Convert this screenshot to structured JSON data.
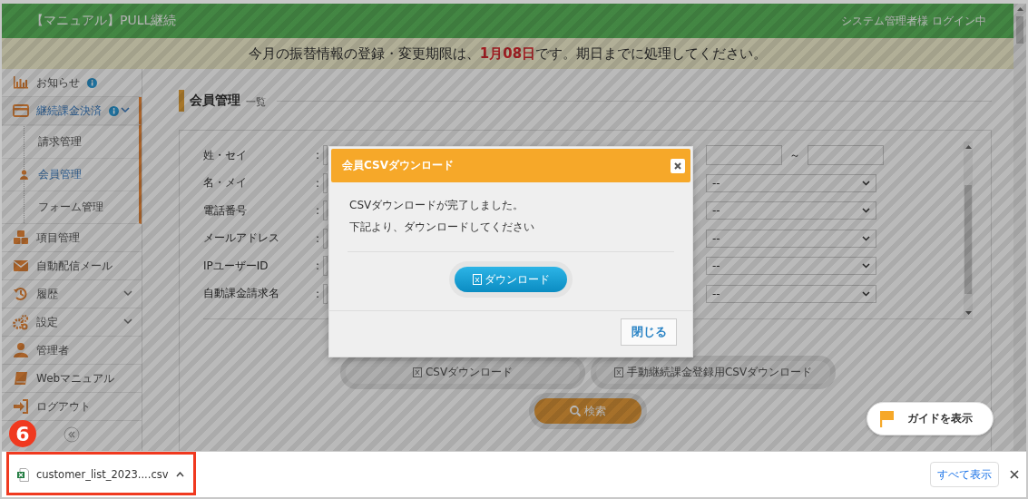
{
  "header": {
    "title": "【マニュアル】PULL継続",
    "user": "システム管理者様 ログイン中"
  },
  "notice": {
    "text": "今月の振替情報の登録・変更期限は、**1月08日**です。期日までに処理してください。"
  },
  "sidebar": {
    "items": [
      {
        "label": "お知らせ",
        "info": true,
        "selected": false
      },
      {
        "label": "継続課金決済",
        "info": true,
        "selected": true,
        "expanded": true,
        "children": [
          {
            "label": "請求管理",
            "selected": false
          },
          {
            "label": "会員管理",
            "selected": true
          },
          {
            "label": "フォーム管理",
            "selected": false
          }
        ]
      },
      {
        "label": "項目管理",
        "info": false,
        "selected": false
      },
      {
        "label": "自動配信メール",
        "info": false,
        "selected": false
      },
      {
        "label": "履歴",
        "info": false,
        "selected": false,
        "expanded": false
      },
      {
        "label": "設定",
        "info": false,
        "selected": false,
        "expanded": false
      },
      {
        "label": "管理者",
        "info": false,
        "selected": false
      },
      {
        "label": "Webマニュアル",
        "info": false,
        "selected": false
      },
      {
        "label": "ログアウト",
        "info": false,
        "selected": false
      }
    ]
  },
  "page": {
    "title": "会員管理",
    "subtitle": "一覧"
  },
  "search_form": {
    "fields": [
      {
        "label": "姓・セイ",
        "colon": ":"
      },
      {
        "label": "名・メイ",
        "colon": ":"
      },
      {
        "label": "電話番号",
        "colon": ":"
      },
      {
        "label": "メールアドレス",
        "colon": ":"
      },
      {
        "label": "IPユーザーID",
        "colon": ":"
      },
      {
        "label": "自動課金請求名",
        "colon": ":"
      }
    ],
    "right_rows": [
      {
        "kind": "range",
        "separator": "～"
      },
      {
        "kind": "select",
        "value": "--"
      },
      {
        "kind": "select",
        "value": "--"
      },
      {
        "kind": "select",
        "value": "--"
      },
      {
        "kind": "select",
        "value": "--"
      },
      {
        "kind": "select",
        "value": "--"
      }
    ],
    "buttons": [
      "CSVダウンロード",
      "手動継続課金登録用CSVダウンロード"
    ],
    "search": "検索"
  },
  "modal": {
    "title": "会員CSVダウンロード",
    "lines": [
      "CSVダウンロードが完了しました。",
      "下記より、ダウンロードしてください"
    ],
    "download": "ダウンロード",
    "close": "閉じる"
  },
  "guide": {
    "label": "ガイドを表示"
  },
  "step": {
    "number": "6"
  },
  "download_bar": {
    "file": "customer_list_2023....csv",
    "show_all": "すべて表示"
  }
}
